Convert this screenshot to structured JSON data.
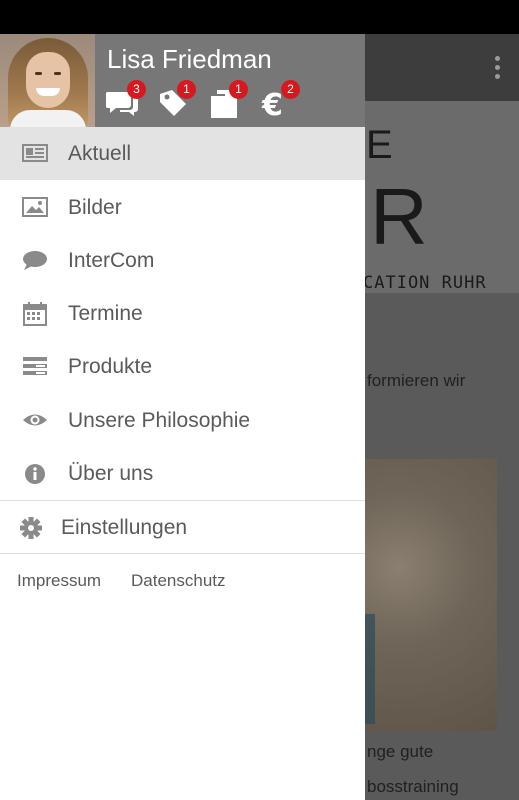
{
  "background": {
    "logo_top": "E",
    "logo_letters": "R",
    "logo_subtitle": "CATION RUHR",
    "text_lines": [
      "formieren wir",
      "nge gute",
      "bosstraining"
    ]
  },
  "drawer": {
    "user_name": "Lisa Friedman",
    "notifications": [
      {
        "icon": "chat-icon",
        "count": "3"
      },
      {
        "icon": "tag-icon",
        "count": "1"
      },
      {
        "icon": "documents-icon",
        "count": "1"
      },
      {
        "icon": "euro-icon",
        "count": "2"
      }
    ],
    "menu": [
      {
        "label": "Aktuell",
        "icon": "news-icon",
        "active": true
      },
      {
        "label": "Bilder",
        "icon": "image-icon"
      },
      {
        "label": "InterCom",
        "icon": "chat-bubble-icon"
      },
      {
        "label": "Termine",
        "icon": "calendar-icon"
      },
      {
        "label": "Produkte",
        "icon": "list-icon"
      },
      {
        "label": "Unsere Philosophie",
        "icon": "eye-icon"
      },
      {
        "label": "Über uns",
        "icon": "info-icon"
      }
    ],
    "settings_label": "Einstellungen",
    "footer": {
      "impressum": "Impressum",
      "datenschutz": "Datenschutz"
    }
  }
}
